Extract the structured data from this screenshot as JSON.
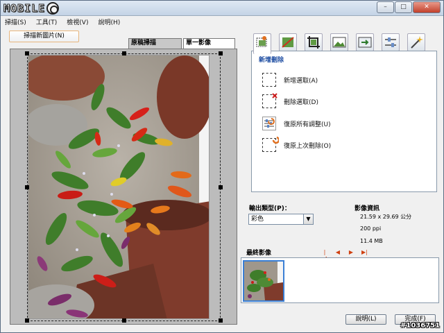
{
  "app": {
    "logo_text": "MOBILE"
  },
  "window_controls": {
    "minimize": "–",
    "maximize": "□",
    "close": "✕"
  },
  "menu": [
    "掃描(S)",
    "工具(T)",
    "檢視(V)",
    "說明(H)"
  ],
  "scan_new_button": "掃描新圖片(N)",
  "view_tabs": [
    {
      "label": "原稿掃描",
      "active": true
    },
    {
      "label": "單一影像",
      "active": false
    }
  ],
  "tool_icons": [
    "crop-tool-icon",
    "adjust-tool-icon",
    "rotate-tool-icon",
    "image-tool-icon",
    "export-tool-icon",
    "settings-tool-icon",
    "magic-tool-icon"
  ],
  "options_panel": {
    "title": "新增刪除",
    "items": [
      {
        "label": "新增選取(A)",
        "icon": "add-selection-icon"
      },
      {
        "label": "刪除選取(D)",
        "icon": "delete-selection-icon"
      },
      {
        "label": "復原所有調整(U)",
        "icon": "undo-adjustments-icon"
      },
      {
        "label": "復原上次刪除(O)",
        "icon": "undo-delete-icon"
      }
    ]
  },
  "output": {
    "label": "輸出類型(P)：",
    "selected": "彩色"
  },
  "image_info": {
    "title": "影像資訊",
    "size": "21.59 x 29.69 公分",
    "resolution": "200 ppi",
    "file_size": "11.4 MB"
  },
  "final_image": {
    "label": "最終影像"
  },
  "buttons": {
    "help": "說明(L)",
    "done": "完成(F)"
  },
  "watermark": "#1036751",
  "colors": {
    "accent_blue": "#1a4aa0",
    "nav_arrow": "#d04010",
    "title_gradient": "#c4d4e6"
  }
}
